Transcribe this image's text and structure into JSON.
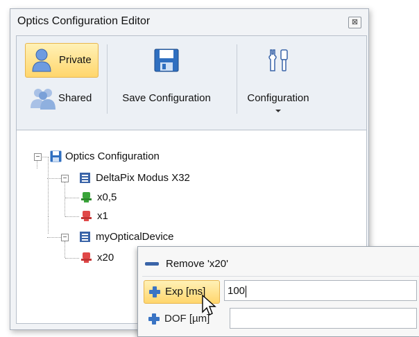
{
  "window": {
    "title": "Optics Configuration Editor",
    "close_glyph": "⊠"
  },
  "ribbon": {
    "private_label": "Private",
    "shared_label": "Shared",
    "save_label": "Save Configuration",
    "configuration_label": "Configuration"
  },
  "tree": {
    "root": "Optics Configuration",
    "devices": [
      {
        "name": "DeltaPix Modus X32",
        "objectives": [
          {
            "name": "x0,5",
            "color": "#3aa53a"
          },
          {
            "name": "x1",
            "color": "#e04848"
          }
        ]
      },
      {
        "name": "myOpticalDevice",
        "objectives": [
          {
            "name": "x20",
            "color": "#e04848"
          }
        ]
      }
    ]
  },
  "popup": {
    "remove_label": "Remove 'x20'",
    "exp_label": "Exp [ms]",
    "exp_value": "100",
    "dof_label": "DOF [µm]",
    "dof_value": ""
  },
  "colors": {
    "accent_highlight": "#ffd66d",
    "icon_blue": "#3a64a8",
    "green": "#3aa53a",
    "red": "#e04848"
  }
}
